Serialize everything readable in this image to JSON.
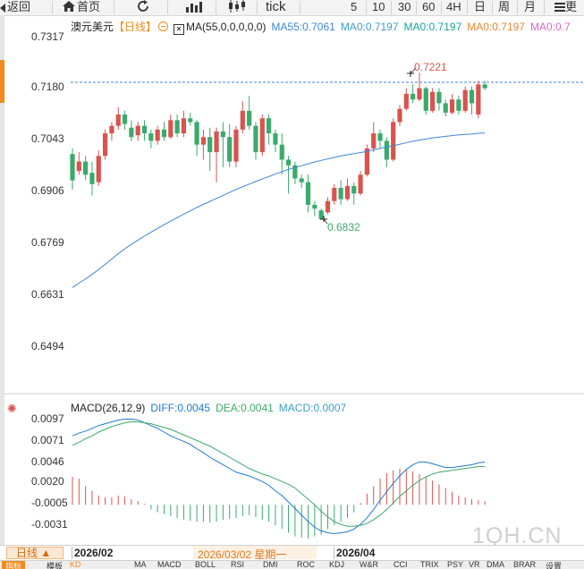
{
  "toolbar": {
    "back_label": "返回",
    "home_label": "首页",
    "tick_label": "tick",
    "periods": [
      "5",
      "10",
      "30",
      "60",
      "4H",
      "日",
      "周",
      "月"
    ],
    "more_label": "更"
  },
  "chart_header": {
    "symbol": "澳元美元",
    "period_tag": "【日线】",
    "ma_params": "MA(55,0,0,0,0,0)",
    "ma55": "MA55:0.7061",
    "ma0_a": "MA0:0.7197",
    "ma0_b": "MA0:0.7197",
    "ma0_c": "MA0:0.7197",
    "ma0_d": "MA0:0.7"
  },
  "price_axis": [
    "0.7317",
    "0.7180",
    "0.7043",
    "0.6906",
    "0.6769",
    "0.6631",
    "0.6494"
  ],
  "annotations": {
    "high": "0.7221",
    "low": "0.6832"
  },
  "macd_header": {
    "title": "MACD(26,12,9)",
    "diff": "DIFF:0.0045",
    "dea": "DEA:0.0041",
    "macd": "MACD:0.0007"
  },
  "macd_axis": [
    "0.0097",
    "0.0071",
    "0.0046",
    "0.0020",
    "-0.0005",
    "-0.0031"
  ],
  "date_axis": {
    "period_button": "日线 ▲",
    "start": "2026/02",
    "cursor": "2026/03/02 星期一",
    "apr": "2026/04"
  },
  "bottom_tabs": [
    "指标",
    "模板",
    "KD",
    "MA",
    "MACD",
    "BOLL",
    "RSI",
    "DMI",
    "ROC",
    "KDJ",
    "W&R",
    "CCI",
    "TRIX",
    "PSY",
    "VR",
    "DMA",
    "BRAR",
    "设置"
  ],
  "watermark": "1QH.CN",
  "colors": {
    "up": "#d9534f",
    "down": "#3aaa6c",
    "ma55": "#3d86d6",
    "diff": "#1f7ad0",
    "dea": "#3aaa6c",
    "dash": "#3d86d6",
    "accent": "#f28a1d"
  },
  "chart_data": {
    "type": "candlestick",
    "ylim": [
      0.6494,
      0.7317
    ],
    "candles": [
      [
        0.7005,
        0.6935,
        0.702,
        0.691
      ],
      [
        0.696,
        0.6985,
        0.701,
        0.695
      ],
      [
        0.6985,
        0.695,
        0.7,
        0.6935
      ],
      [
        0.6955,
        0.6925,
        0.6985,
        0.6895
      ],
      [
        0.693,
        0.7,
        0.7015,
        0.692
      ],
      [
        0.7,
        0.706,
        0.707,
        0.699
      ],
      [
        0.706,
        0.708,
        0.709,
        0.704
      ],
      [
        0.708,
        0.711,
        0.713,
        0.707
      ],
      [
        0.711,
        0.7085,
        0.712,
        0.707
      ],
      [
        0.7075,
        0.705,
        0.7095,
        0.704
      ],
      [
        0.7055,
        0.708,
        0.709,
        0.704
      ],
      [
        0.708,
        0.706,
        0.7095,
        0.704
      ],
      [
        0.706,
        0.704,
        0.707,
        0.702
      ],
      [
        0.704,
        0.707,
        0.708,
        0.703
      ],
      [
        0.707,
        0.705,
        0.709,
        0.704
      ],
      [
        0.705,
        0.7095,
        0.711,
        0.7045
      ],
      [
        0.7095,
        0.706,
        0.711,
        0.705
      ],
      [
        0.706,
        0.71,
        0.712,
        0.705
      ],
      [
        0.71,
        0.709,
        0.7115,
        0.708
      ],
      [
        0.709,
        0.703,
        0.7095,
        0.7
      ],
      [
        0.703,
        0.705,
        0.707,
        0.699
      ],
      [
        0.705,
        0.701,
        0.7075,
        0.696
      ],
      [
        0.701,
        0.7065,
        0.7075,
        0.693
      ],
      [
        0.7065,
        0.705,
        0.709,
        0.697
      ],
      [
        0.705,
        0.6985,
        0.7085,
        0.697
      ],
      [
        0.6985,
        0.707,
        0.708,
        0.697
      ],
      [
        0.707,
        0.712,
        0.7145,
        0.706
      ],
      [
        0.712,
        0.708,
        0.716,
        0.707
      ],
      [
        0.708,
        0.701,
        0.709,
        0.699
      ],
      [
        0.701,
        0.71,
        0.711,
        0.7
      ],
      [
        0.71,
        0.706,
        0.711,
        0.703
      ],
      [
        0.706,
        0.703,
        0.707,
        0.701
      ],
      [
        0.703,
        0.699,
        0.706,
        0.695
      ],
      [
        0.699,
        0.6975,
        0.7,
        0.69
      ],
      [
        0.6975,
        0.694,
        0.6985,
        0.6925
      ],
      [
        0.694,
        0.693,
        0.695,
        0.6915
      ],
      [
        0.693,
        0.687,
        0.695,
        0.685
      ],
      [
        0.687,
        0.686,
        0.688,
        0.684
      ],
      [
        0.6855,
        0.6832,
        0.686,
        0.6832
      ],
      [
        0.685,
        0.688,
        0.689,
        0.6845
      ],
      [
        0.688,
        0.6915,
        0.6925,
        0.687
      ],
      [
        0.6915,
        0.6885,
        0.6935,
        0.687
      ],
      [
        0.6885,
        0.692,
        0.694,
        0.688
      ],
      [
        0.692,
        0.69,
        0.693,
        0.687
      ],
      [
        0.69,
        0.695,
        0.696,
        0.6895
      ],
      [
        0.695,
        0.702,
        0.703,
        0.6945
      ],
      [
        0.702,
        0.706,
        0.709,
        0.701
      ],
      [
        0.706,
        0.704,
        0.707,
        0.702
      ],
      [
        0.704,
        0.699,
        0.705,
        0.697
      ],
      [
        0.699,
        0.709,
        0.71,
        0.6985
      ],
      [
        0.709,
        0.7125,
        0.7135,
        0.708
      ],
      [
        0.7125,
        0.7165,
        0.718,
        0.712
      ],
      [
        0.7165,
        0.715,
        0.719,
        0.714
      ],
      [
        0.715,
        0.718,
        0.7221,
        0.7145
      ],
      [
        0.718,
        0.712,
        0.7185,
        0.711
      ],
      [
        0.712,
        0.717,
        0.718,
        0.7115
      ],
      [
        0.717,
        0.714,
        0.718,
        0.712
      ],
      [
        0.714,
        0.7115,
        0.715,
        0.7105
      ],
      [
        0.7115,
        0.715,
        0.7165,
        0.711
      ],
      [
        0.715,
        0.712,
        0.716,
        0.711
      ],
      [
        0.712,
        0.7175,
        0.7185,
        0.7115
      ],
      [
        0.7175,
        0.714,
        0.7185,
        0.711
      ],
      [
        0.711,
        0.719,
        0.72,
        0.71
      ],
      [
        0.719,
        0.718,
        0.72,
        0.7175
      ]
    ],
    "ma55": [
      0.665,
      0.6662,
      0.6673,
      0.6685,
      0.6698,
      0.6712,
      0.6726,
      0.674,
      0.6753,
      0.6765,
      0.6776,
      0.6787,
      0.6797,
      0.6807,
      0.6817,
      0.6827,
      0.6836,
      0.6845,
      0.6854,
      0.6863,
      0.6871,
      0.6879,
      0.6887,
      0.6895,
      0.6903,
      0.6911,
      0.6918,
      0.6925,
      0.6932,
      0.6939,
      0.6945,
      0.6952,
      0.6958,
      0.6964,
      0.6969,
      0.6974,
      0.6979,
      0.6984,
      0.6988,
      0.6992,
      0.6996,
      0.7,
      0.7003,
      0.7006,
      0.7009,
      0.7012,
      0.7016,
      0.702,
      0.7024,
      0.7027,
      0.7031,
      0.7035,
      0.7039,
      0.7042,
      0.7045,
      0.7048,
      0.705,
      0.7052,
      0.7054,
      0.7056,
      0.7057,
      0.7058,
      0.706,
      0.7061
    ],
    "macd": {
      "ylim": [
        -0.0042,
        0.0102
      ],
      "diff": [
        0.0074,
        0.0077,
        0.0079,
        0.0082,
        0.0085,
        0.0087,
        0.0089,
        0.0091,
        0.0092,
        0.0092,
        0.0091,
        0.0088,
        0.0085,
        0.0082,
        0.0078,
        0.0074,
        0.0071,
        0.0068,
        0.0065,
        0.006,
        0.0056,
        0.0051,
        0.0047,
        0.0043,
        0.0039,
        0.0035,
        0.0033,
        0.0031,
        0.0028,
        0.0025,
        0.0021,
        0.0015,
        0.001,
        0.0003,
        -0.0004,
        -0.0011,
        -0.0018,
        -0.0024,
        -0.0028,
        -0.003,
        -0.0031,
        -0.003,
        -0.0029,
        -0.0026,
        -0.0021,
        -0.0014,
        -0.0005,
        0.0005,
        0.0014,
        0.0023,
        0.0031,
        0.0038,
        0.0043,
        0.0046,
        0.0046,
        0.0044,
        0.0042,
        0.004,
        0.004,
        0.0041,
        0.0042,
        0.0043,
        0.0045,
        0.0046
      ],
      "dea": [
        0.0064,
        0.0067,
        0.0071,
        0.0074,
        0.0078,
        0.0081,
        0.0084,
        0.0086,
        0.0088,
        0.0089,
        0.0089,
        0.0088,
        0.0087,
        0.0085,
        0.0083,
        0.0081,
        0.0078,
        0.0075,
        0.0072,
        0.0069,
        0.0066,
        0.0063,
        0.0059,
        0.0055,
        0.0051,
        0.0047,
        0.0043,
        0.0039,
        0.0036,
        0.0033,
        0.0031,
        0.0028,
        0.0025,
        0.0022,
        0.0018,
        0.0012,
        0.0006,
        0.0,
        -0.0007,
        -0.0013,
        -0.0018,
        -0.0021,
        -0.0023,
        -0.0023,
        -0.0022,
        -0.002,
        -0.0016,
        -0.0011,
        -0.0005,
        0.0002,
        0.0009,
        0.0015,
        0.0021,
        0.0026,
        0.003,
        0.0033,
        0.0035,
        0.0036,
        0.0037,
        0.0038,
        0.0039,
        0.004,
        0.0041,
        0.0041
      ],
      "hist": [
        0.003,
        0.0028,
        0.002,
        0.0015,
        0.001,
        0.0008,
        0.0008,
        0.001,
        0.0009,
        0.0006,
        0.0004,
        0.0001,
        -0.0005,
        -0.0008,
        -0.001,
        -0.0012,
        -0.0014,
        -0.0016,
        -0.0017,
        -0.0018,
        -0.0018,
        -0.0019,
        -0.0018,
        -0.0016,
        -0.0015,
        -0.0014,
        -0.0012,
        -0.0011,
        -0.0013,
        -0.0016,
        -0.0018,
        -0.0022,
        -0.0026,
        -0.003,
        -0.0034,
        -0.0035,
        -0.0036,
        -0.0034,
        -0.0032,
        -0.0026,
        -0.0022,
        -0.0018,
        -0.0014,
        -0.0008,
        0.0002,
        0.0012,
        0.002,
        0.0028,
        0.0034,
        0.0037,
        0.0039,
        0.0038,
        0.0036,
        0.0033,
        0.003,
        0.0026,
        0.0022,
        0.0018,
        0.0014,
        0.001,
        0.0008,
        0.0006,
        0.0005,
        0.0004
      ]
    }
  }
}
